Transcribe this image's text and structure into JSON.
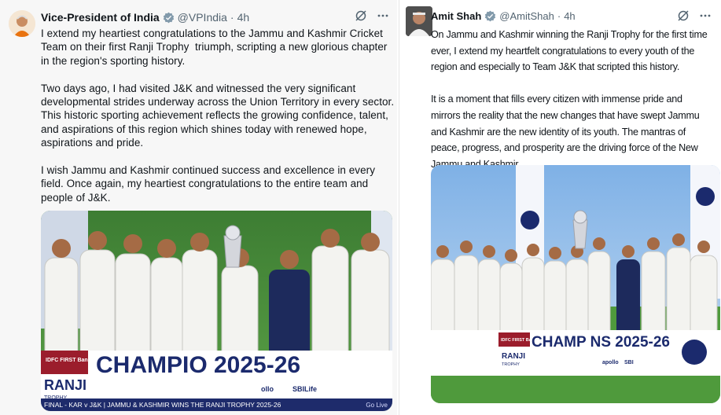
{
  "tweets": [
    {
      "author": "Vice-President of India",
      "handle": "@VPIndia",
      "separator": "·",
      "time": "4h",
      "text": "I extend my heartiest congratulations to the Jammu and Kashmir Cricket Team on their first Ranji Trophy  triumph, scripting a new glorious chapter in the region's sporting history.\n\nTwo days ago, I had visited J&K and witnessed the very significant developmental strides underway across the Union Territory in every sector. This historic sporting achievement reflects the growing confidence, talent, and aspirations of this region which shines today with renewed hope, aspirations and pride.\n\nI wish Jammu and Kashmir continued success and excellence in every field. Once again, my heartiest congratulations to the entire team and people of J&K.",
      "image": {
        "banner_text": "CHAMPIO 2025-26",
        "sponsor_idfc": "IDFC FIRST Bank",
        "sponsor_ranji": "RANJI",
        "sponsor_trophy": "TROPHY",
        "sponsor_sbi": "SBILife",
        "sponsor_apollo": "ollo",
        "ticker_text": "FINAL - KAR v J&K | JAMMU & KASHMIR WINS THE RANJI TROPHY 2025-26",
        "ticker_live": "Go Live"
      }
    },
    {
      "author": "Amit Shah",
      "handle": "@AmitShah",
      "separator": "·",
      "time": "4h",
      "text": "On Jammu and Kashmir winning the Ranji Trophy for the first time ever, I extend my heartfelt congratulations to every youth of the region and especially to Team J&K that scripted this history.\n\nIt is a moment that fills every citizen with immense pride and mirrors the reality that the new changes that have swept Jammu and Kashmir are the new identity of its youth. The mantras of peace, progress, and prosperity are the driving force of the New Jammu and Kashmir.",
      "image": {
        "banner_text": "CHAMP  NS 2025-26",
        "sponsor_idfc": "IDFC FIRST Bank",
        "sponsor_ranji": "RANJI",
        "sponsor_trophy": "TROPHY",
        "sponsor_apollo": "apollo",
        "sponsor_sbi": "SBI"
      }
    }
  ],
  "colors": {
    "verified": "#1d9bf0",
    "muted": "#536471",
    "grass": "#4a8f3a",
    "sky": "#8fb8e6",
    "banner_blue": "#1b2a6d",
    "ticker": "#1e2b6b"
  },
  "icons": [
    "verified-badge-icon",
    "grok-icon",
    "more-icon"
  ]
}
